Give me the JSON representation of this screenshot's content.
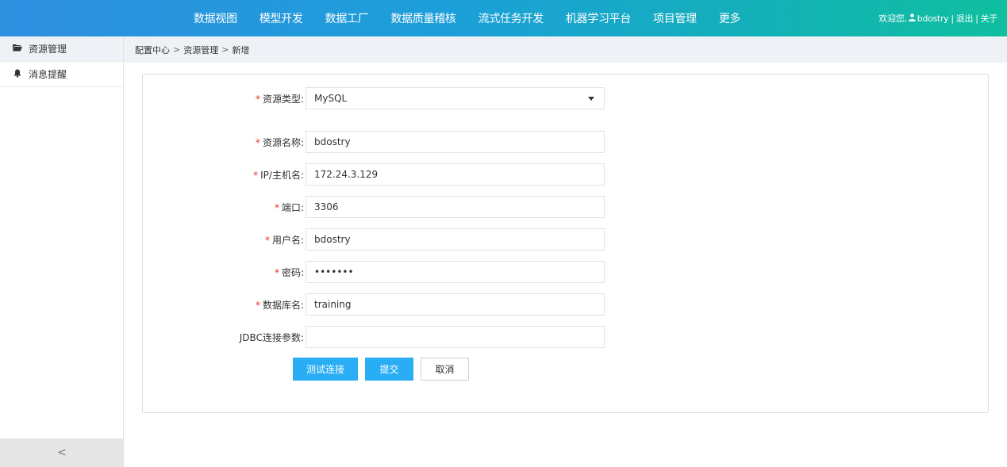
{
  "header": {
    "nav": [
      "数据视图",
      "模型开发",
      "数据工厂",
      "数据质量稽核",
      "流式任务开发",
      "机器学习平台",
      "项目管理",
      "更多"
    ],
    "welcome": "欢迎您,",
    "username": "bdostry",
    "logout": "退出",
    "about": "关于",
    "separator": "|"
  },
  "sidebar": {
    "items": [
      {
        "label": "资源管理",
        "icon": "folder-open-icon"
      },
      {
        "label": "消息提醒",
        "icon": "bell-icon"
      }
    ],
    "collapse_icon": "chevron-left-icon",
    "collapse_glyph": "<"
  },
  "breadcrumb": {
    "items": [
      "配置中心",
      "资源管理",
      "新增"
    ],
    "separator": ">"
  },
  "form": {
    "required_mark": "*",
    "resource_type": {
      "label": "资源类型:",
      "value": "MySQL"
    },
    "resource_name": {
      "label": "资源名称:",
      "value": "bdostry"
    },
    "host": {
      "label": "IP/主机名:",
      "value": "172.24.3.129"
    },
    "port": {
      "label": "端口:",
      "value": "3306"
    },
    "user": {
      "label": "用户名:",
      "value": "bdostry"
    },
    "password": {
      "label": "密码:",
      "value": "•••••••"
    },
    "database": {
      "label": "数据库名:",
      "value": "training"
    },
    "jdbc": {
      "label": "JDBC连接参数:",
      "value": ""
    }
  },
  "buttons": {
    "test": "测试连接",
    "submit": "提交",
    "cancel": "取消"
  },
  "colors": {
    "primary_button": "#29aef5",
    "required": "#e5332a",
    "header_start": "#2f8fe0",
    "header_end": "#0fbf9f"
  }
}
